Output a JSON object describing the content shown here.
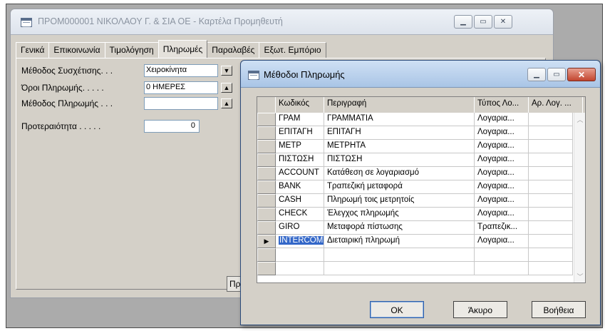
{
  "card": {
    "title": "ΠΡΟΜ000001 ΝΙΚΟΛΑΟΥ Γ. & ΣΙΑ ΟΕ - Καρτέλα Προμηθευτή",
    "tabs": [
      "Γενικά",
      "Επικοινωνία",
      "Τιμολόγηση",
      "Πληρωμές",
      "Παραλαβές",
      "Εξωτ. Εμπόριο"
    ],
    "active_tab": "Πληρωμές",
    "fields": {
      "matching_method_label": "Μέθοδος Συσχέτισης. . .",
      "matching_method_value": "Χειροκίνητα",
      "payment_terms_label": "Όροι Πληρωμής. . . . .",
      "payment_terms_value": "0 ΗΜΕΡΕΣ",
      "payment_method_label": "Μέθοδος Πληρωμής . . .",
      "payment_method_value": "",
      "priority_label": "Προτεραιότητα . . . . .",
      "priority_value": "0"
    },
    "partial_button_label": "Πρ"
  },
  "dialog": {
    "title": "Μέθοδοι Πληρωμής",
    "columns": [
      "Κωδικός",
      "Περιγραφή",
      "Τύπος Λο...",
      "Αρ. Λογ. ..."
    ],
    "rows": [
      {
        "code": "ΓΡΑΜ",
        "description": "ΓΡΑΜΜΑΤΙΑ",
        "type": "Λογαρια...",
        "account": ""
      },
      {
        "code": "ΕΠΙΤΑΓΗ",
        "description": "ΕΠΙΤΑΓΗ",
        "type": "Λογαρια...",
        "account": ""
      },
      {
        "code": "ΜΕΤΡ",
        "description": "ΜΕΤΡΗΤΑ",
        "type": "Λογαρια...",
        "account": ""
      },
      {
        "code": "ΠΙΣΤΩΣΗ",
        "description": "ΠΙΣΤΩΣΗ",
        "type": "Λογαρια...",
        "account": ""
      },
      {
        "code": "ACCOUNT",
        "description": "Κατάθεση σε λογαριασμό",
        "type": "Λογαρια...",
        "account": ""
      },
      {
        "code": "BANK",
        "description": "Τραπεζική μεταφορά",
        "type": "Λογαρια...",
        "account": ""
      },
      {
        "code": "CASH",
        "description": "Πληρωμή τοις μετρητοίς",
        "type": "Λογαρια...",
        "account": ""
      },
      {
        "code": "CHECK",
        "description": "Έλεγχος πληρωμής",
        "type": "Λογαρια...",
        "account": ""
      },
      {
        "code": "GIRO",
        "description": "Μεταφορά πίστωσης",
        "type": "Τραπεζικ...",
        "account": ""
      },
      {
        "code": "INTERCOM",
        "description": "Διεταιρική πληρωμή",
        "type": "Λογαρια...",
        "account": ""
      }
    ],
    "selected_row": 9,
    "empty_rows": 2,
    "buttons": {
      "ok": "OK",
      "cancel": "Άκυρο",
      "help": "Βοήθεια"
    }
  },
  "icons": {
    "window": "window-icon",
    "minimize": "minimize-icon",
    "maximize": "maximize-icon",
    "close": "close-icon",
    "dropdown": "dropdown-arrow-icon",
    "lookup": "lookup-up-arrow-icon",
    "row_pointer": "row-pointer-icon"
  },
  "colors": {
    "selection": "#3367c8",
    "dialog_titlebar": "#a9c5e6",
    "close_button": "#c2452f"
  }
}
